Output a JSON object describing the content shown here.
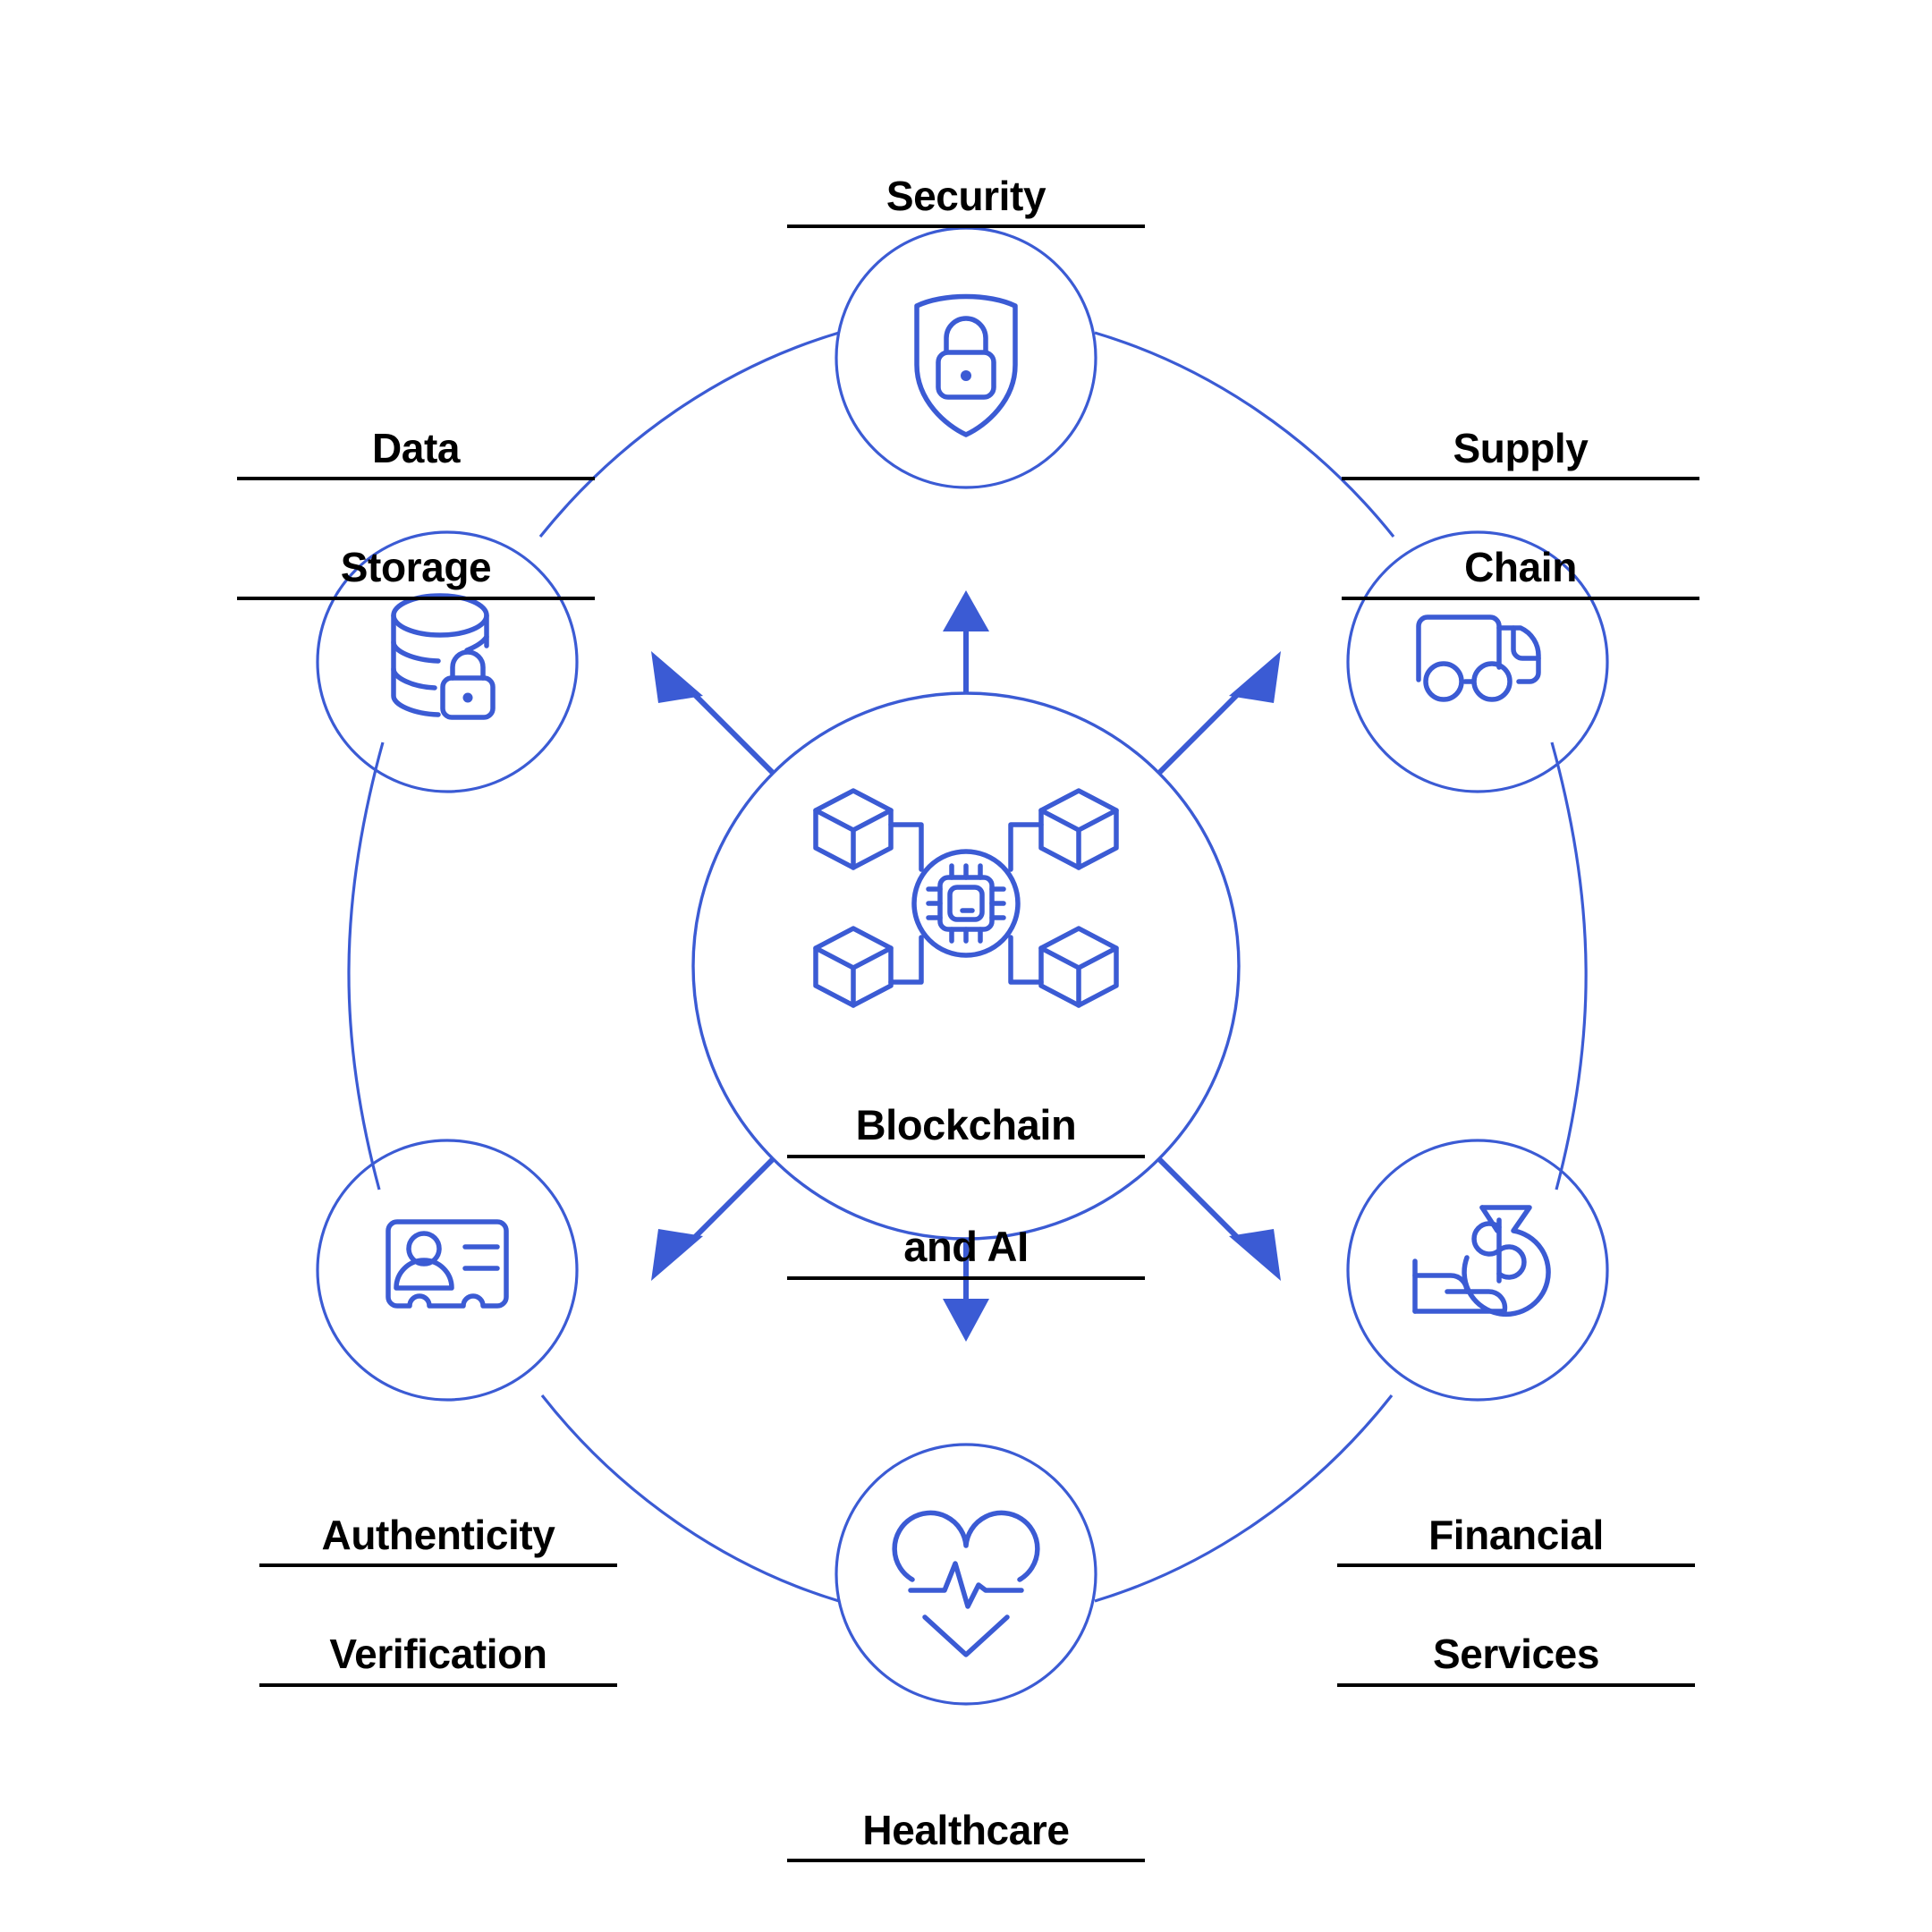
{
  "diagram": {
    "title": "Blockchain and AI applications hub-and-spoke diagram",
    "accent_color": "#3b5bd4",
    "text_color": "#000000",
    "background_color": "#ffffff"
  },
  "center": {
    "label_line1": "Blockchain",
    "label_line2": "and AI",
    "icon": "blockchain-network-chip-icon"
  },
  "nodes": [
    {
      "id": "security",
      "label_line1": "Security",
      "label_line2": "",
      "icon": "shield-lock-icon",
      "position": "top"
    },
    {
      "id": "supply-chain",
      "label_line1": "Supply",
      "label_line2": "Chain",
      "icon": "delivery-truck-icon",
      "position": "upper-right"
    },
    {
      "id": "financial-services",
      "label_line1": "Financial",
      "label_line2": "Services",
      "icon": "hand-money-bag-icon",
      "position": "lower-right"
    },
    {
      "id": "healthcare",
      "label_line1": "Healthcare",
      "label_line2": "",
      "icon": "heart-pulse-icon",
      "position": "bottom"
    },
    {
      "id": "authenticity-verification",
      "label_line1": "Authenticity",
      "label_line2": "Verification",
      "icon": "id-card-person-icon",
      "position": "lower-left"
    },
    {
      "id": "data-storage",
      "label_line1": "Data",
      "label_line2": "Storage",
      "icon": "database-lock-icon",
      "position": "upper-left"
    }
  ],
  "chart_data": {
    "type": "diagram",
    "layout": "radial hub-and-spoke",
    "hub": "Blockchain and AI",
    "spokes": [
      "Security",
      "Supply Chain",
      "Financial Services",
      "Healthcare",
      "Authenticity Verification",
      "Data Storage"
    ],
    "arrow_count": 8,
    "arrow_directions": [
      "up",
      "up-right",
      "right",
      "down-right",
      "down",
      "down-left",
      "left",
      "up-left"
    ],
    "title": "Blockchain and AI"
  }
}
